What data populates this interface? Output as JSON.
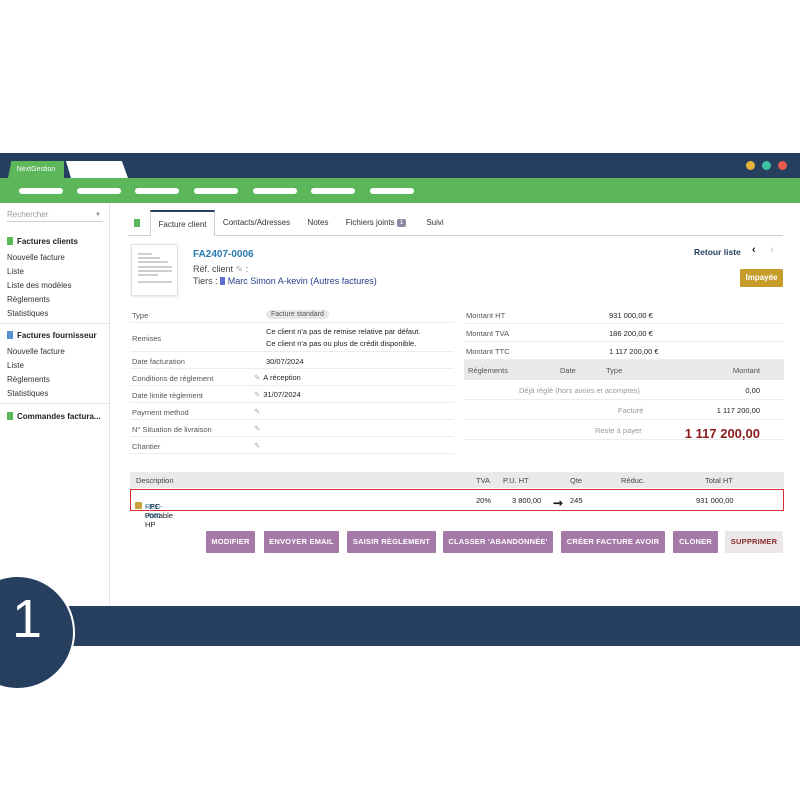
{
  "app": {
    "brand_tab": "NextGestion"
  },
  "colors": {
    "navy": "#263f5f",
    "green": "#5cb65a",
    "button_purple": "#a57aa8",
    "status_gold": "#c69d2a",
    "amount_red": "#8b1a1a",
    "highlight_red": "#d62e2e"
  },
  "window_controls": [
    "yellow-dot",
    "teal-dot",
    "red-dot"
  ],
  "sidebar": {
    "search_placeholder": "Rechercher",
    "sections": [
      {
        "title": "Factures clients",
        "icon": "invoice-icon",
        "items": [
          "Nouvelle facture",
          "Liste",
          "Liste des modèles",
          "Règlements",
          "Statistiques"
        ]
      },
      {
        "title": "Factures fournisseur",
        "icon": "invoice-icon",
        "items": [
          "Nouvelle facture",
          "Liste",
          "Règlements",
          "Statistiques"
        ]
      },
      {
        "title": "Commandes factura...",
        "icon": "invoice-icon",
        "items": []
      }
    ]
  },
  "tabs": [
    {
      "label": "Facture client",
      "active": true
    },
    {
      "label": "Contacts/Adresses"
    },
    {
      "label": "Notes"
    },
    {
      "label": "Fichiers joints",
      "badge": "1"
    },
    {
      "label": "Suivi"
    }
  ],
  "invoice": {
    "ref": "FA2407-0006",
    "ref_client_label": "Réf. client",
    "ref_client_suffix": " :",
    "tiers_label": "Tiers :",
    "tiers_value": "Marc Simon A-kevin",
    "tiers_extra": "(Autres factures)",
    "back_link": "Retour liste",
    "status": "Impayée"
  },
  "fields": [
    {
      "label": "Type",
      "value": "Facture standard"
    },
    {
      "label": "Remises",
      "value": "Ce client n'a pas de remise relative par défaut.",
      "value2": "Ce client n'a pas ou plus de crédit disponible."
    },
    {
      "label": "Date facturation",
      "value": "30/07/2024"
    },
    {
      "label": "Conditions de règlement",
      "value": "A réception"
    },
    {
      "label": "Date limite règlement",
      "value": "31/07/2024"
    },
    {
      "label": "Payment method",
      "value": ""
    },
    {
      "label": "N° Situation de livraison",
      "value": ""
    },
    {
      "label": "Chantier",
      "value": ""
    }
  ],
  "amounts": [
    {
      "label": "Montant HT",
      "value": "931 000,00 €"
    },
    {
      "label": "Montant TVA",
      "value": "186 200,00 €"
    },
    {
      "label": "Montant TTC",
      "value": "1 117 200,00 €"
    }
  ],
  "payments": {
    "headers": [
      "Règlements",
      "Date",
      "Type",
      "Montant"
    ],
    "already_paid_label": "Déjà réglé (hors avoirs et acomptes)",
    "already_paid_value": "0,00",
    "billed_label": "Facturé",
    "billed_value": "1 117 200,00",
    "remaining_label": "Reste à payer",
    "remaining_value": "1 117 200,00"
  },
  "lines": {
    "headers": [
      "Description",
      "TVA",
      "P.U. HT",
      "Qte",
      "Réduc.",
      "Total HT"
    ],
    "rows": [
      {
        "ref": "REF-0001",
        "desc": " - PC Portable HP",
        "tva": "20%",
        "pu": "3 800,00",
        "qty": "245",
        "reduc": "",
        "total": "931 000,00"
      }
    ]
  },
  "buttons": [
    "MODIFIER",
    "ENVOYER EMAIL",
    "SAISIR RÈGLEMENT",
    "CLASSER 'ABANDONNÉE'",
    "CRÉER FACTURE AVOIR",
    "CLONER",
    "SUPPRIMER"
  ],
  "step_number": "1"
}
